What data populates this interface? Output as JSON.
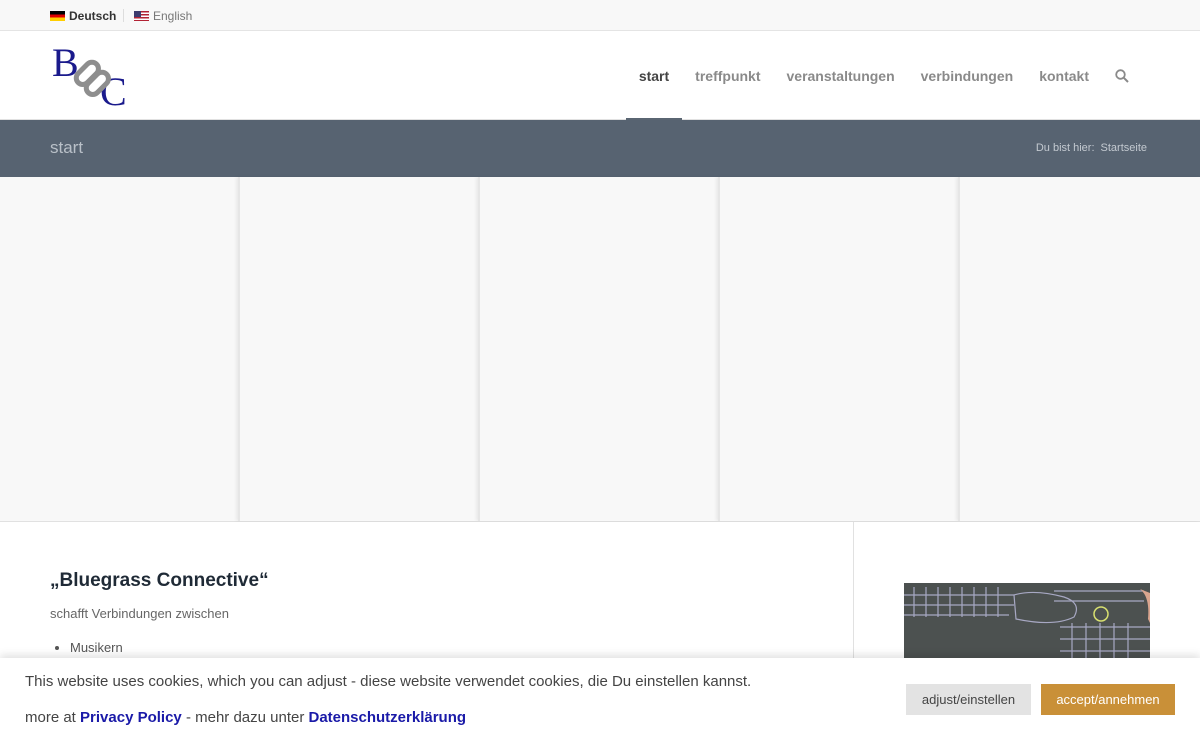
{
  "languages": [
    {
      "label": "Deutsch",
      "active": true,
      "flag": "flag-germany-icon"
    },
    {
      "label": "English",
      "active": false,
      "flag": "flag-usa-icon"
    }
  ],
  "logo": {
    "letter_b": "B",
    "letter_c": "C"
  },
  "nav": {
    "items": [
      {
        "label": "start",
        "active": true
      },
      {
        "label": "treffpunkt",
        "active": false
      },
      {
        "label": "veranstaltungen",
        "active": false
      },
      {
        "label": "verbindungen",
        "active": false
      },
      {
        "label": "kontakt",
        "active": false
      }
    ],
    "search_icon": "search-icon"
  },
  "titlebar": {
    "title": "start",
    "breadcrumb_prefix": "Du bist hier:",
    "breadcrumb_link": "Startseite"
  },
  "main": {
    "heading": "„Bluegrass Connective“",
    "subline": "schafft Verbindungen zwischen",
    "list": [
      "Musikern"
    ]
  },
  "cookie": {
    "text1": "This website uses cookies, which you can adjust - diese website verwendet cookies, die Du einstellen kannst.",
    "text2_prefix": "more at",
    "privacy_link": "Privacy Policy",
    "text2_middle": "- mehr dazu unter",
    "datenschutz_link": "Datenschutzerklärung",
    "adjust_label": "adjust/einstellen",
    "accept_label": "accept/annehmen"
  },
  "colors": {
    "titlebar": "#576371",
    "accent_button": "#c99038",
    "logo_blue": "#1a1a8c",
    "logo_chain": "#8e8e8e"
  }
}
